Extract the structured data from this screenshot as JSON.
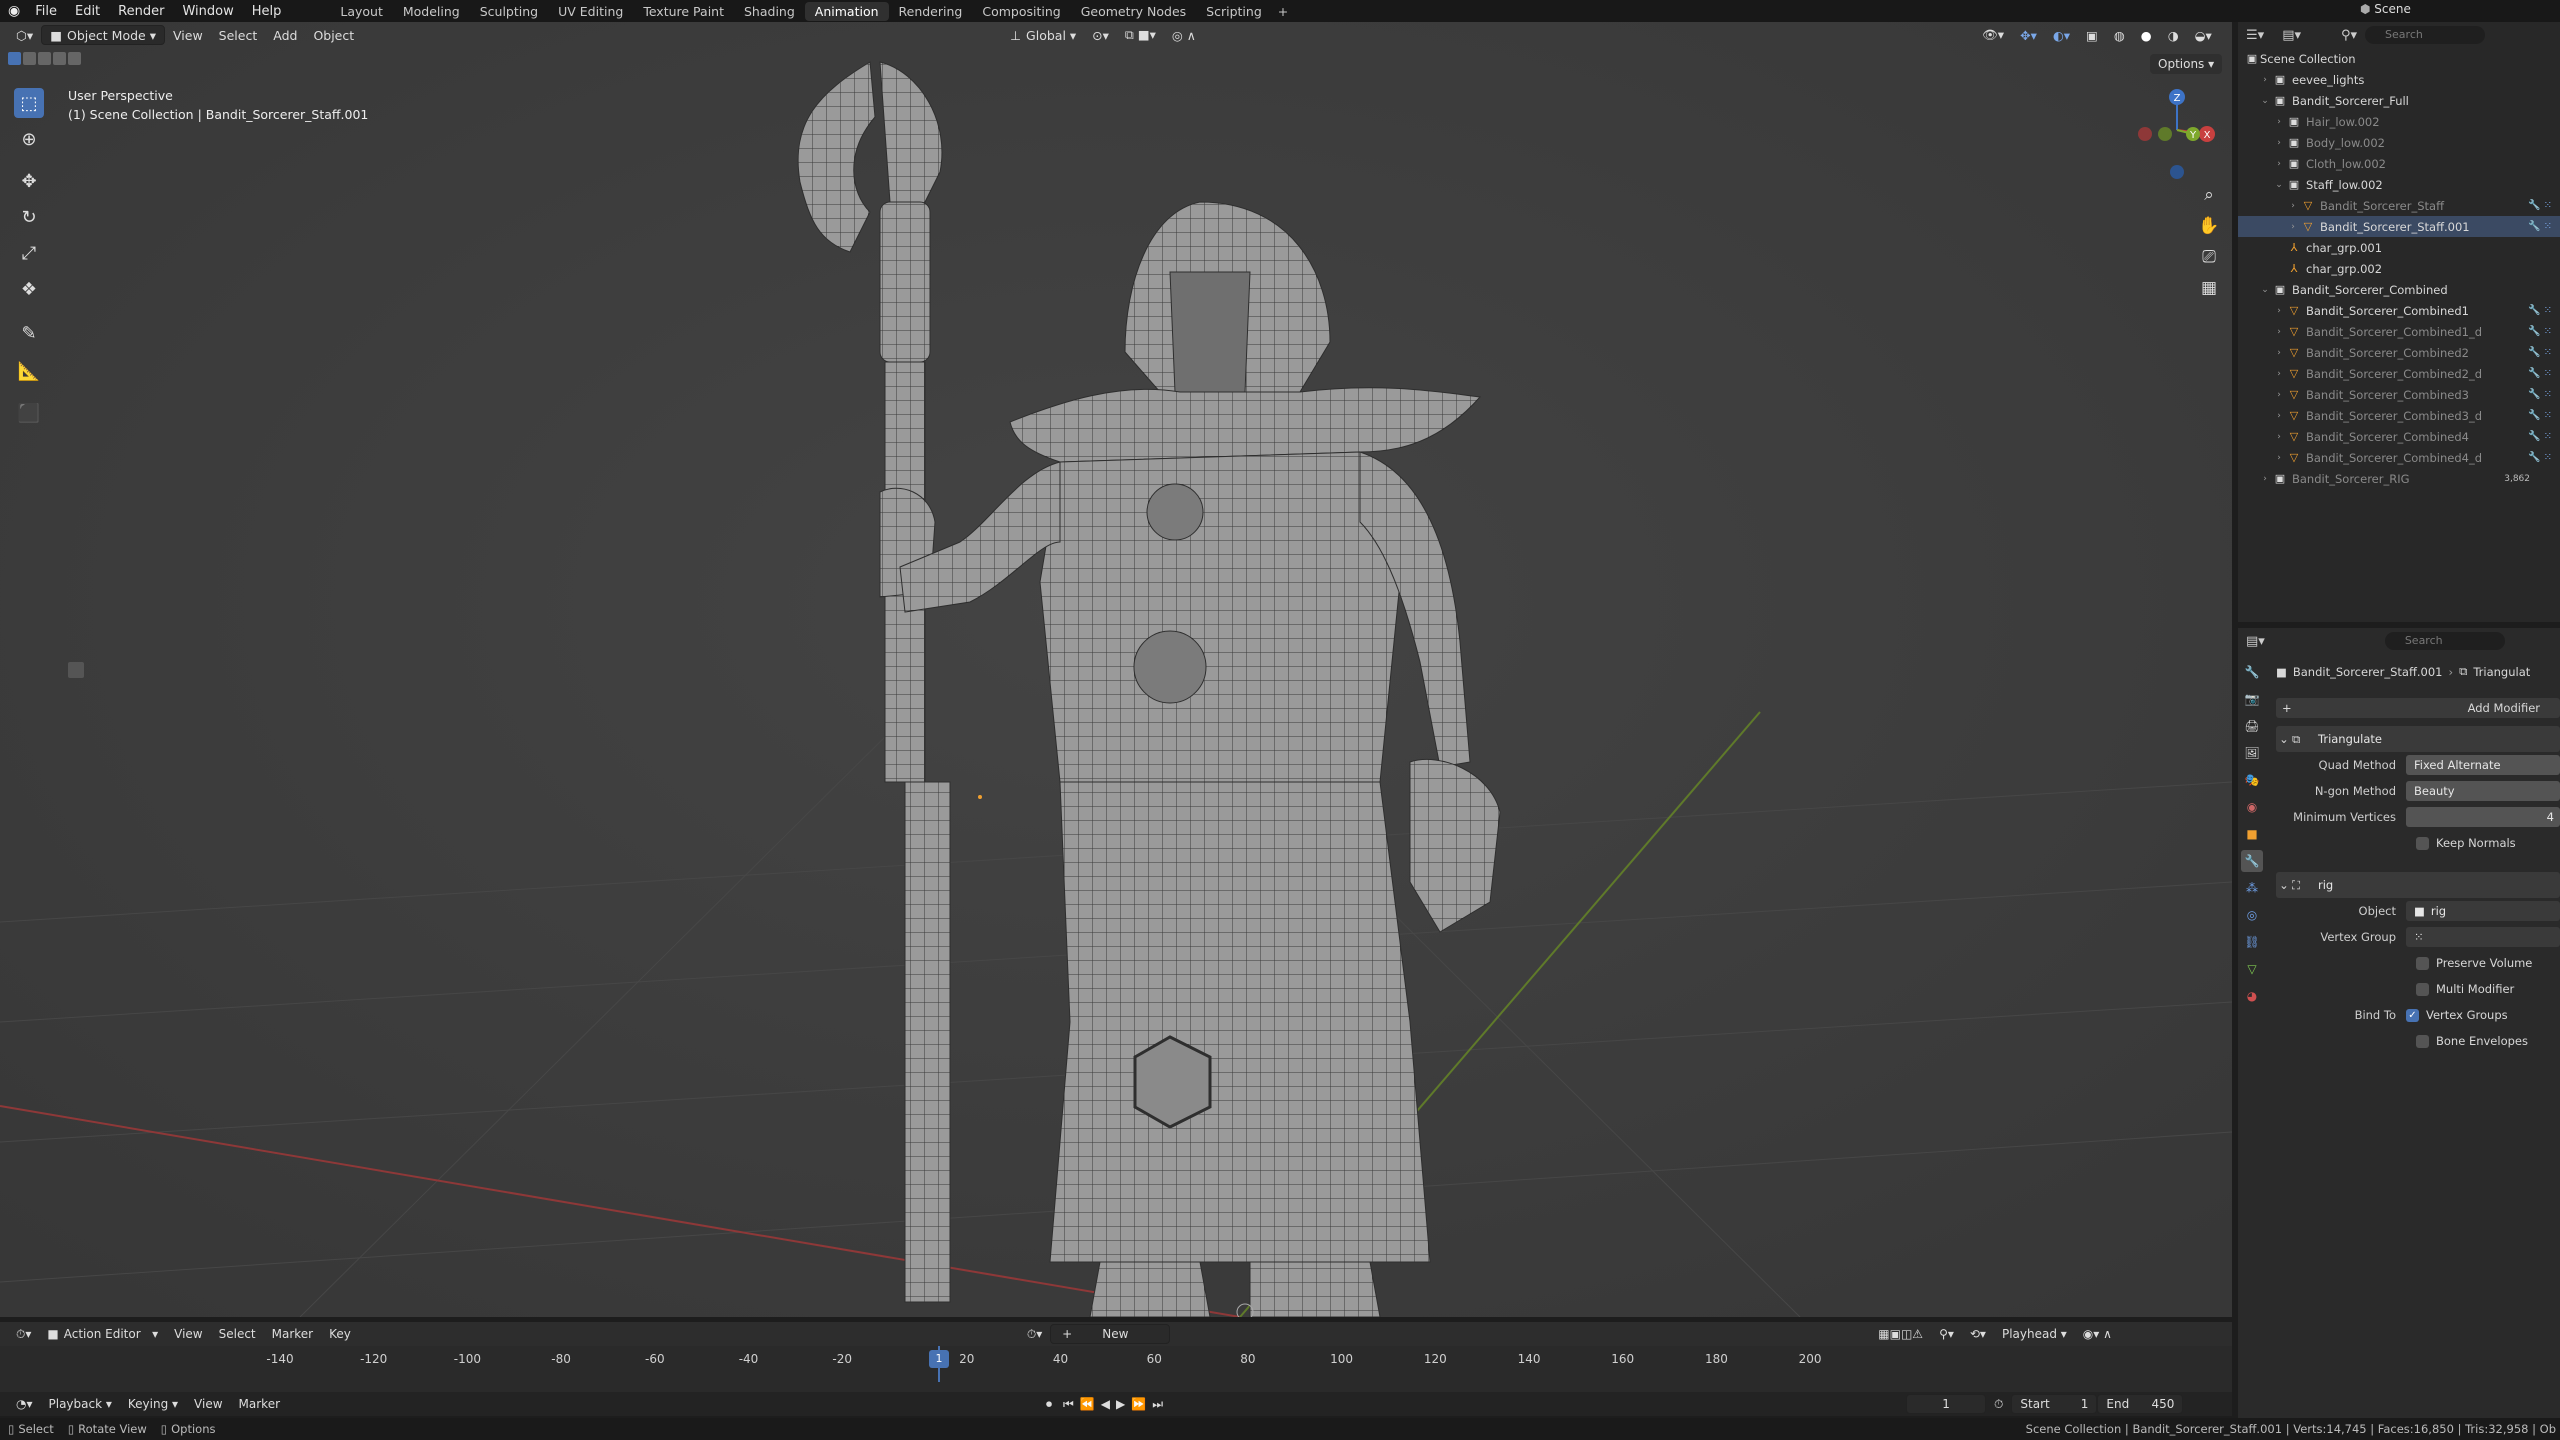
{
  "topbar": {
    "menus": [
      "File",
      "Edit",
      "Render",
      "Window",
      "Help"
    ],
    "workspaces": [
      "Layout",
      "Modeling",
      "Sculpting",
      "UV Editing",
      "Texture Paint",
      "Shading",
      "Animation",
      "Rendering",
      "Compositing",
      "Geometry Nodes",
      "Scripting"
    ],
    "active_workspace": "Animation",
    "scene": "Scene"
  },
  "viewport": {
    "mode": "Object Mode",
    "menus": [
      "View",
      "Select",
      "Add",
      "Object"
    ],
    "transform_orientation": "Global",
    "options_label": "Options",
    "overlay_line1": "User Perspective",
    "overlay_line2": "(1) Scene Collection | Bandit_Sorcerer_Staff.001",
    "gizmo_axes": {
      "x": "X",
      "y": "Y",
      "z": "Z"
    }
  },
  "outliner": {
    "search_placeholder": "Search",
    "root": "Scene Collection",
    "rows": [
      {
        "label": "eevee_lights",
        "indent": 1,
        "icon": "collection",
        "expanded": false,
        "dim": false
      },
      {
        "label": "Bandit_Sorcerer_Full",
        "indent": 1,
        "icon": "collection",
        "expanded": true,
        "dim": false
      },
      {
        "label": "Hair_low.002",
        "indent": 2,
        "icon": "collection",
        "expanded": false,
        "dim": true
      },
      {
        "label": "Body_low.002",
        "indent": 2,
        "icon": "collection",
        "expanded": false,
        "dim": true
      },
      {
        "label": "Cloth_low.002",
        "indent": 2,
        "icon": "collection",
        "expanded": false,
        "dim": true
      },
      {
        "label": "Staff_low.002",
        "indent": 2,
        "icon": "collection",
        "expanded": true,
        "dim": false
      },
      {
        "label": "Bandit_Sorcerer_Staff",
        "indent": 3,
        "icon": "mesh",
        "expanded": false,
        "dim": true
      },
      {
        "label": "Bandit_Sorcerer_Staff.001",
        "indent": 3,
        "icon": "mesh",
        "expanded": false,
        "dim": false,
        "selected": true
      },
      {
        "label": "char_grp.001",
        "indent": 2,
        "icon": "armature",
        "expanded": null,
        "dim": false
      },
      {
        "label": "char_grp.002",
        "indent": 2,
        "icon": "armature",
        "expanded": null,
        "dim": false
      },
      {
        "label": "Bandit_Sorcerer_Combined",
        "indent": 1,
        "icon": "collection",
        "expanded": true,
        "dim": false
      },
      {
        "label": "Bandit_Sorcerer_Combined1",
        "indent": 2,
        "icon": "mesh",
        "expanded": false,
        "dim": false
      },
      {
        "label": "Bandit_Sorcerer_Combined1_d",
        "indent": 2,
        "icon": "mesh",
        "expanded": false,
        "dim": true
      },
      {
        "label": "Bandit_Sorcerer_Combined2",
        "indent": 2,
        "icon": "mesh",
        "expanded": false,
        "dim": true
      },
      {
        "label": "Bandit_Sorcerer_Combined2_d",
        "indent": 2,
        "icon": "mesh",
        "expanded": false,
        "dim": true
      },
      {
        "label": "Bandit_Sorcerer_Combined3",
        "indent": 2,
        "icon": "mesh",
        "expanded": false,
        "dim": true
      },
      {
        "label": "Bandit_Sorcerer_Combined3_d",
        "indent": 2,
        "icon": "mesh",
        "expanded": false,
        "dim": true
      },
      {
        "label": "Bandit_Sorcerer_Combined4",
        "indent": 2,
        "icon": "mesh",
        "expanded": false,
        "dim": true
      },
      {
        "label": "Bandit_Sorcerer_Combined4_d",
        "indent": 2,
        "icon": "mesh",
        "expanded": false,
        "dim": true
      },
      {
        "label": "Bandit_Sorcerer_RIG",
        "indent": 1,
        "icon": "collection",
        "expanded": false,
        "dim": true
      }
    ],
    "rig_badge": "3,862"
  },
  "properties": {
    "search_placeholder": "Search",
    "breadcrumb_object": "Bandit_Sorcerer_Staff.001",
    "breadcrumb_modifier": "Triangulat",
    "add_modifier": "Add Modifier",
    "triangulate": {
      "name": "Triangulate",
      "quad_method_label": "Quad Method",
      "quad_method": "Fixed Alternate",
      "ngon_method_label": "N-gon Method",
      "ngon_method": "Beauty",
      "min_vertices_label": "Minimum Vertices",
      "min_vertices": "4",
      "keep_normals_label": "Keep Normals"
    },
    "armature": {
      "name": "rig",
      "object_label": "Object",
      "object_value": "rig",
      "vertex_group_label": "Vertex Group",
      "preserve_volume_label": "Preserve Volume",
      "multi_modifier_label": "Multi Modifier",
      "bind_to_label": "Bind To",
      "vertex_groups_label": "Vertex Groups",
      "bone_envelopes_label": "Bone Envelopes"
    }
  },
  "timeline": {
    "editor": "Action Editor",
    "menus": [
      "View",
      "Select",
      "Marker",
      "Key"
    ],
    "new_label": "New",
    "playhead_label": "Playhead",
    "ticks": [
      "-140",
      "-120",
      "-100",
      "-80",
      "-60",
      "-40",
      "-20",
      "1",
      "20",
      "40",
      "60",
      "80",
      "100",
      "120",
      "140",
      "160",
      "180",
      "200"
    ],
    "current_frame": "1",
    "playback_menus": [
      "Playback",
      "Keying",
      "View",
      "Marker"
    ],
    "frame_field": "1",
    "start_label": "Start",
    "start": "1",
    "end_label": "End",
    "end": "450"
  },
  "statusbar": {
    "hints": [
      "Select",
      "Rotate View",
      "Options"
    ],
    "info": "Scene Collection | Bandit_Sorcerer_Staff.001 | Verts:14,745 | Faces:16,850 | Tris:32,958 | Ob"
  },
  "colors": {
    "accent": "#4772b3",
    "x_axis": "#c8403f",
    "y_axis": "#7ea82c",
    "z_axis": "#3d73c7",
    "object_orange": "#f0a030"
  }
}
